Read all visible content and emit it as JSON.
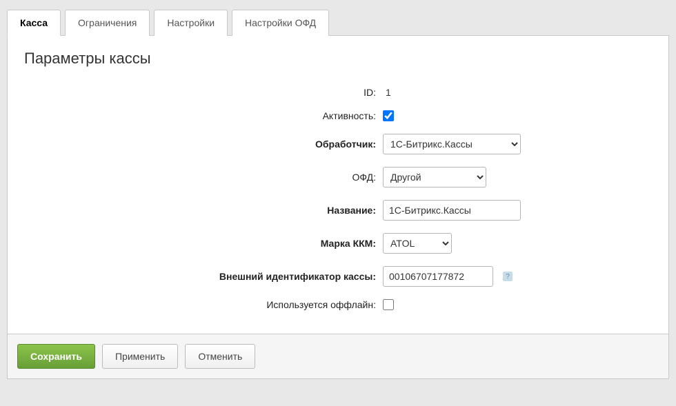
{
  "tabs": [
    {
      "label": "Касса",
      "active": true
    },
    {
      "label": "Ограничения",
      "active": false
    },
    {
      "label": "Настройки",
      "active": false
    },
    {
      "label": "Настройки ОФД",
      "active": false
    }
  ],
  "page_title": "Параметры кассы",
  "form": {
    "id_label": "ID:",
    "id_value": "1",
    "active_label": "Активность:",
    "active_checked": true,
    "handler_label": "Обработчик:",
    "handler_value": "1С-Битрикс.Кассы",
    "ofd_label": "ОФД:",
    "ofd_value": "Другой",
    "name_label": "Название:",
    "name_value": "1С-Битрикс.Кассы",
    "kkm_label": "Марка ККМ:",
    "kkm_value": "ATOL",
    "ext_id_label": "Внешний идентификатор кассы:",
    "ext_id_value": "00106707177872",
    "offline_label": "Используется оффлайн:",
    "offline_checked": false
  },
  "buttons": {
    "save": "Сохранить",
    "apply": "Применить",
    "cancel": "Отменить"
  },
  "help_glyph": "?"
}
